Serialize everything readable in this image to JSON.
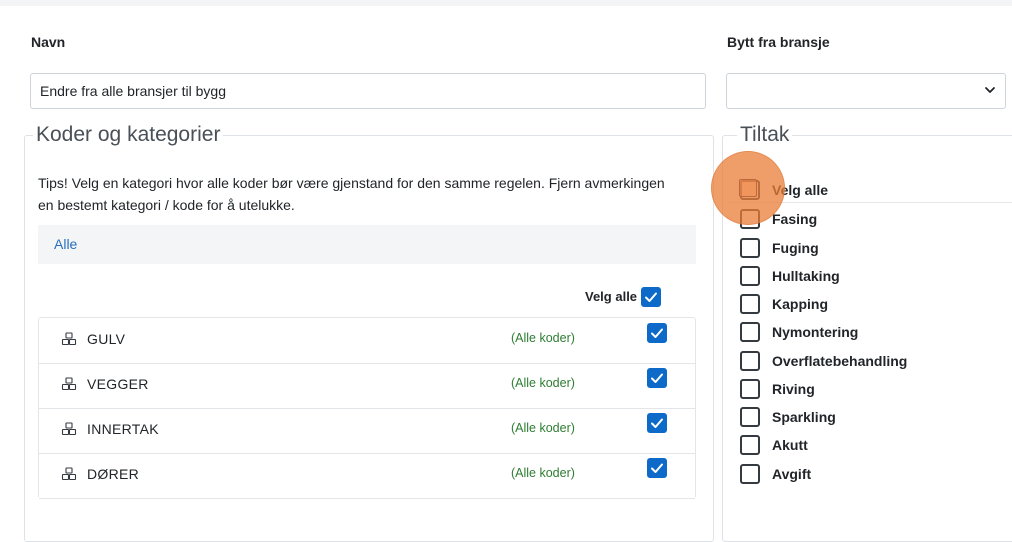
{
  "form": {
    "name_label": "Navn",
    "name_value": "Endre fra alle bransjer til bygg",
    "swap_label": "Bytt fra bransje",
    "swap_value": ""
  },
  "koder": {
    "legend": "Koder og kategorier",
    "tips": "Tips! Velg en kategori hvor alle koder bør være gjenstand for den samme regelen. Fjern avmerkingen en bestemt kategori / kode for å utelukke.",
    "alle_link": "Alle",
    "velg_alle": "Velg alle",
    "velg_alle_checked": true,
    "categories": [
      {
        "name": "GULV",
        "codes": "(Alle koder)",
        "checked": true
      },
      {
        "name": "VEGGER",
        "codes": "(Alle koder)",
        "checked": true
      },
      {
        "name": "INNERTAK",
        "codes": "(Alle koder)",
        "checked": true
      },
      {
        "name": "DØRER",
        "codes": "(Alle koder)",
        "checked": true
      }
    ]
  },
  "tiltak": {
    "legend": "Tiltak",
    "velg_alle": "Velg alle",
    "items": [
      {
        "label": "Fasing",
        "checked": false
      },
      {
        "label": "Fuging",
        "checked": false
      },
      {
        "label": "Hulltaking",
        "checked": false
      },
      {
        "label": "Kapping",
        "checked": false
      },
      {
        "label": "Nymontering",
        "checked": false
      },
      {
        "label": "Overflatebehandling",
        "checked": false
      },
      {
        "label": "Riving",
        "checked": false
      },
      {
        "label": "Sparkling",
        "checked": false
      },
      {
        "label": "Akutt",
        "checked": false
      },
      {
        "label": "Avgift",
        "checked": false
      }
    ]
  },
  "icons": {
    "category": "category-cubes-icon",
    "check": "checkmark-icon",
    "select": "chevron-down-icon"
  },
  "colors": {
    "accent": "#0d6ac8",
    "link": "#2a6fbf",
    "codes_green": "#2e7d32",
    "cursor_highlight": "#eb7d37"
  }
}
